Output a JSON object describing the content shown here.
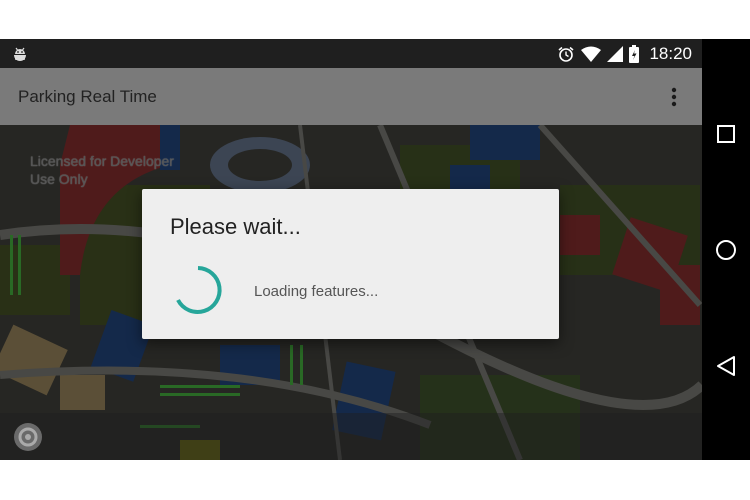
{
  "status_bar": {
    "time": "18:20",
    "icons": [
      "android-debug-icon",
      "alarm-icon",
      "wifi-icon",
      "signal-icon",
      "battery-icon"
    ]
  },
  "app_bar": {
    "title": "Parking Real Time",
    "menu_icon": "more-vert-icon"
  },
  "map": {
    "watermark_line1": "Licensed for Developer",
    "watermark_line2": "Use Only",
    "location_icon": "my-location-icon"
  },
  "dialog": {
    "title": "Please wait...",
    "message": "Loading features...",
    "spinner_color": "#26a69a"
  },
  "nav_bar": {
    "buttons": [
      "recents-icon",
      "home-icon",
      "back-icon"
    ]
  },
  "colors": {
    "accent": "#26a69a",
    "status_bar": "#1f1f1f",
    "app_bar_dimmed": "#7a7a7a"
  }
}
